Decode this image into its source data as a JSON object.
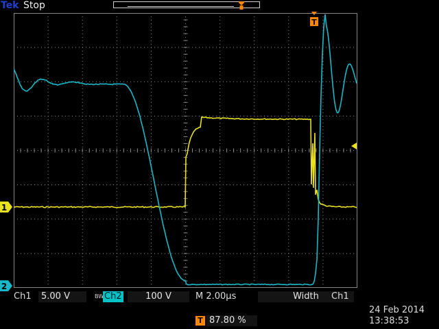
{
  "header": {
    "brand": "Tek",
    "status": "Stop"
  },
  "markers": {
    "trigger_pos": "T",
    "ch1": "1",
    "ch2": "2"
  },
  "readouts": {
    "ch1_label": "Ch1",
    "ch1_scale": "5.00 V",
    "bw_symbol": "BW",
    "ch2_label": "Ch2",
    "ch2_scale": "100 V",
    "timebase": "M 2.00µs",
    "trigger_type": "Width",
    "trigger_source": "Ch1",
    "trigger_marker": "T",
    "trigger_position": "87.80 %"
  },
  "datetime": {
    "date": "24 Feb  2014",
    "time": "13:38:53"
  },
  "colors": {
    "ch1": "#e8e020",
    "ch2": "#18b8c8",
    "trigger": "#ff8800",
    "grid": "#8a8a8a"
  }
}
